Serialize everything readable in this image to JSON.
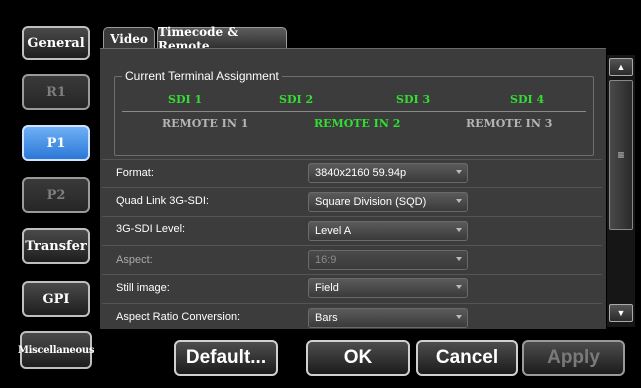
{
  "nav": {
    "general": "General",
    "r1": "R1",
    "p1": "P1",
    "p2": "P2",
    "transfer": "Transfer",
    "gpi": "GPI",
    "misc": "Miscellaneous"
  },
  "tabs": {
    "video": "Video",
    "timecode": "Timecode & Remote"
  },
  "assignment": {
    "title": "Current Terminal Assignment",
    "sdi": [
      "SDI 1",
      "SDI 2",
      "SDI 3",
      "SDI 4"
    ],
    "remote": [
      "REMOTE IN 1",
      "REMOTE IN 2",
      "REMOTE IN 3"
    ]
  },
  "settings": {
    "format": {
      "label": "Format:",
      "value": "3840x2160 59.94p"
    },
    "quadlink": {
      "label": "Quad Link 3G-SDI:",
      "value": "Square Division (SQD)"
    },
    "level": {
      "label": "3G-SDI Level:",
      "value": "Level A"
    },
    "aspect": {
      "label": "Aspect:",
      "value": "16:9"
    },
    "still": {
      "label": "Still image:",
      "value": "Field"
    },
    "arc": {
      "label": "Aspect Ratio Conversion:",
      "value": "Bars"
    }
  },
  "scrollbar": {
    "up": "▲",
    "down": "▼",
    "grip": "≡"
  },
  "buttons": {
    "default": "Default...",
    "ok": "OK",
    "cancel": "Cancel",
    "apply": "Apply"
  },
  "colors": {
    "accent": "#2b78d8",
    "green": "#33dd33"
  }
}
